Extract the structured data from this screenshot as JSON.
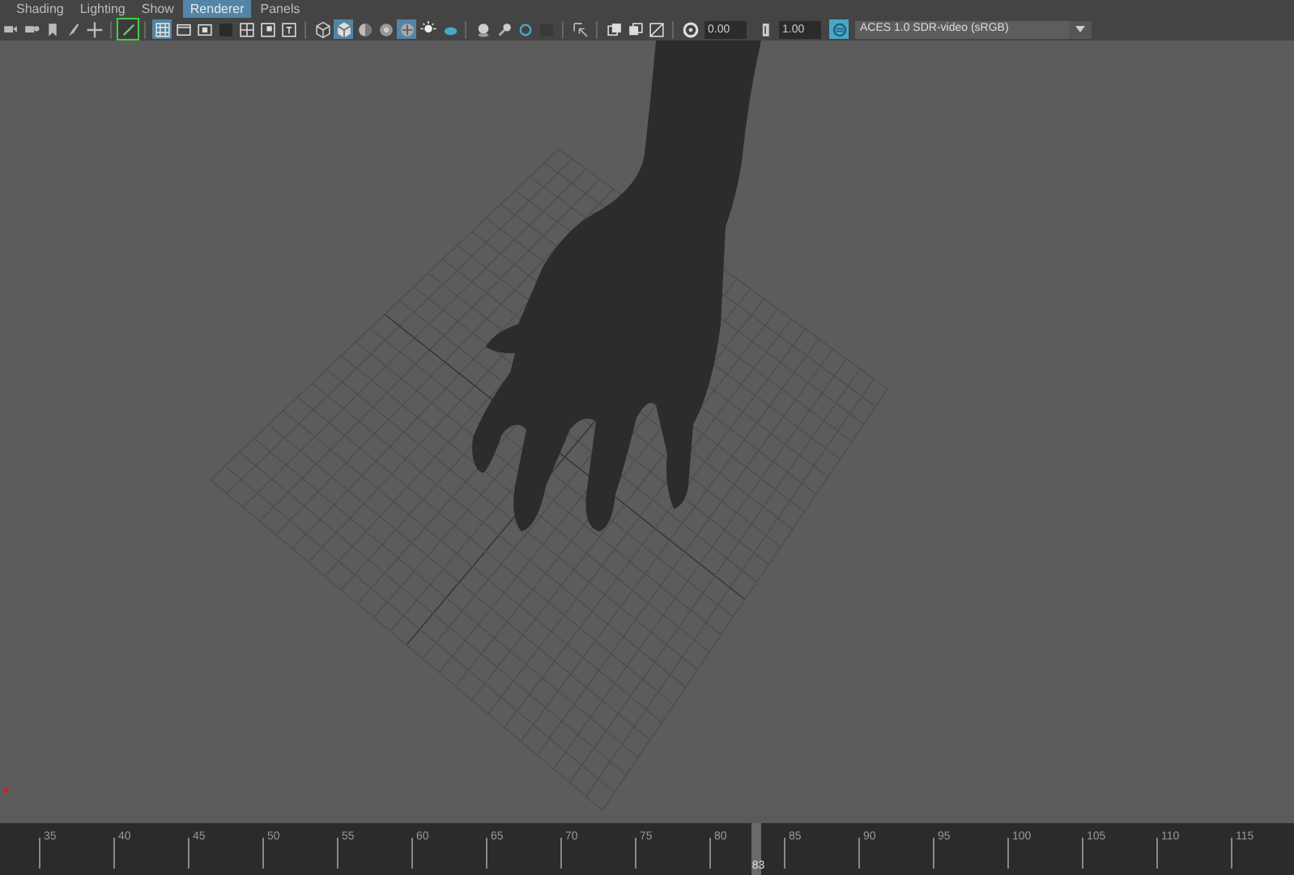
{
  "menu": [
    {
      "label": "Shading",
      "selected": false
    },
    {
      "label": "Lighting",
      "selected": false
    },
    {
      "label": "Show",
      "selected": false
    },
    {
      "label": "Renderer",
      "selected": true
    },
    {
      "label": "Panels",
      "selected": false
    }
  ],
  "toolbar_buttons": [
    {
      "on": false
    },
    {
      "on": false
    },
    {
      "on": false
    },
    {
      "on": false
    },
    {
      "on": false
    },
    {
      "on": true
    },
    {
      "on": true
    },
    {
      "on": false
    },
    {
      "on": false
    },
    {
      "on": false
    },
    {
      "on": false
    },
    {
      "on": false
    },
    {
      "on": false
    },
    {
      "on": false
    },
    {
      "on": true
    },
    {
      "on": false
    },
    {
      "on": false
    },
    {
      "on": true
    },
    {
      "on": false
    },
    {
      "on": false
    },
    {
      "on": false
    },
    {
      "on": false
    },
    {
      "on": false
    },
    {
      "on": false
    },
    {
      "on": false
    },
    {
      "on": false
    },
    {
      "on": false
    },
    {
      "on": false
    }
  ],
  "exposure": "0.00",
  "gamma": "1.00",
  "view_transform": "ACES 1.0 SDR-video (sRGB)",
  "timeline": {
    "ticks": [
      "35",
      "40",
      "45",
      "50",
      "55",
      "60",
      "65",
      "70",
      "75",
      "80",
      "85",
      "90",
      "95",
      "100",
      "105",
      "110",
      "115"
    ],
    "current_frame": "83",
    "level": 0.585
  }
}
